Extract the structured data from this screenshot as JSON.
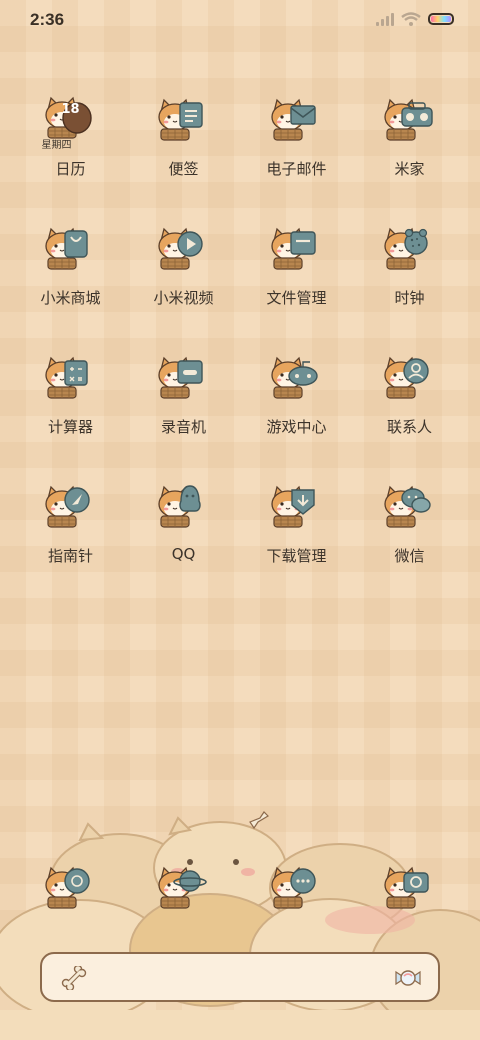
{
  "status_bar": {
    "time": "2:36",
    "signal_icon": "signal-icon",
    "wifi_icon": "wifi-icon",
    "battery_icon": "battery-icon"
  },
  "colors": {
    "background": "#f4dcbd",
    "icon_teal": "#6d8f93",
    "dog_orange": "#e7a55e",
    "text": "#3d342b"
  },
  "calendar_widget": {
    "day": "18",
    "weekday": "星期四"
  },
  "apps": [
    {
      "label": "日历",
      "icon": "calendar-icon"
    },
    {
      "label": "便签",
      "icon": "notes-icon"
    },
    {
      "label": "电子邮件",
      "icon": "email-icon"
    },
    {
      "label": "米家",
      "icon": "mijia-icon"
    },
    {
      "label": "小米商城",
      "icon": "shopping-bag-icon"
    },
    {
      "label": "小米视频",
      "icon": "video-play-icon"
    },
    {
      "label": "文件管理",
      "icon": "folder-icon"
    },
    {
      "label": "时钟",
      "icon": "clock-icon"
    },
    {
      "label": "计算器",
      "icon": "calculator-icon"
    },
    {
      "label": "录音机",
      "icon": "recorder-icon"
    },
    {
      "label": "游戏中心",
      "icon": "gamepad-icon"
    },
    {
      "label": "联系人",
      "icon": "contacts-icon"
    },
    {
      "label": "指南针",
      "icon": "compass-icon"
    },
    {
      "label": "QQ",
      "icon": "qq-icon"
    },
    {
      "label": "下载管理",
      "icon": "download-icon"
    },
    {
      "label": "微信",
      "icon": "wechat-icon"
    }
  ],
  "dock": [
    {
      "icon": "phone-icon"
    },
    {
      "icon": "browser-planet-icon"
    },
    {
      "icon": "messages-icon"
    },
    {
      "icon": "camera-icon"
    }
  ],
  "search_bar": {
    "left_icon": "bone-icon",
    "right_icon": "candy-icon"
  }
}
